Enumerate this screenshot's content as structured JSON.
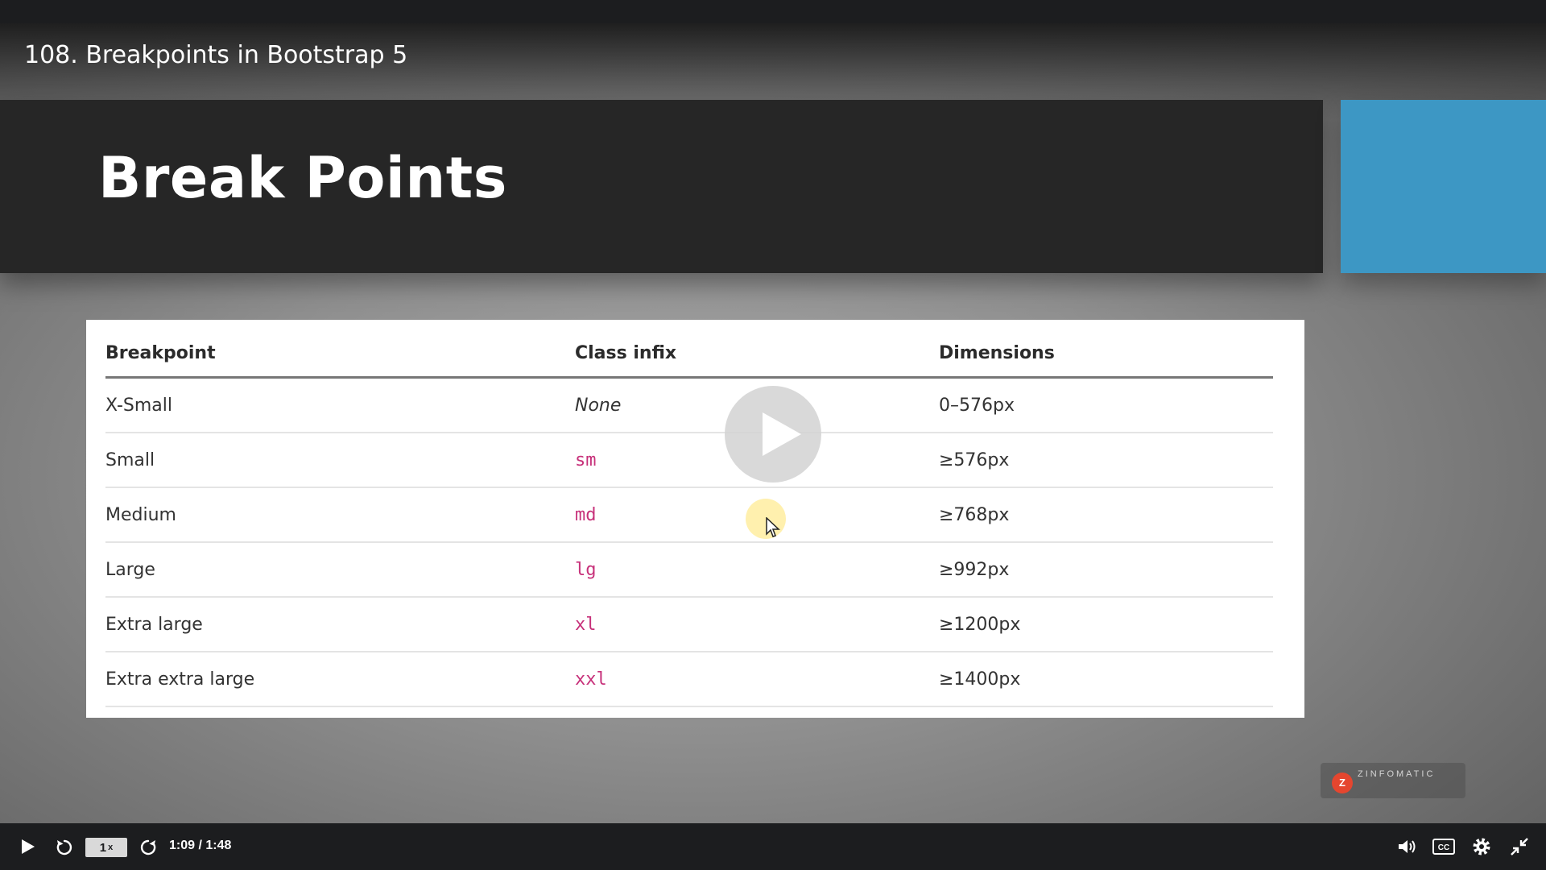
{
  "video": {
    "title": "108. Breakpoints in Bootstrap 5"
  },
  "slide": {
    "title": "Break Points",
    "accent_color": "#3d97c4",
    "table": {
      "headers": [
        "Breakpoint",
        "Class infix",
        "Dimensions"
      ],
      "rows": [
        {
          "breakpoint": "X-Small",
          "infix": "None",
          "dimensions": "0–576px"
        },
        {
          "breakpoint": "Small",
          "infix": "sm",
          "dimensions": "≥576px"
        },
        {
          "breakpoint": "Medium",
          "infix": "md",
          "dimensions": "≥768px"
        },
        {
          "breakpoint": "Large",
          "infix": "lg",
          "dimensions": "≥992px"
        },
        {
          "breakpoint": "Extra large",
          "infix": "xl",
          "dimensions": "≥1200px"
        },
        {
          "breakpoint": "Extra extra large",
          "infix": "xxl",
          "dimensions": "≥1400px"
        }
      ]
    },
    "brand": {
      "logo_letter": "Z",
      "name": "ZINFOMATIC"
    }
  },
  "player": {
    "progress_fraction": 0.639,
    "progress_color": "#e04b4b",
    "speed_value": "1",
    "speed_suffix": "x",
    "time": "1:09 / 1:48",
    "icons": [
      "play-icon",
      "rewind-icon",
      "forward-icon",
      "volume-icon",
      "captions-icon",
      "settings-icon",
      "exit-fullscreen-icon"
    ]
  }
}
